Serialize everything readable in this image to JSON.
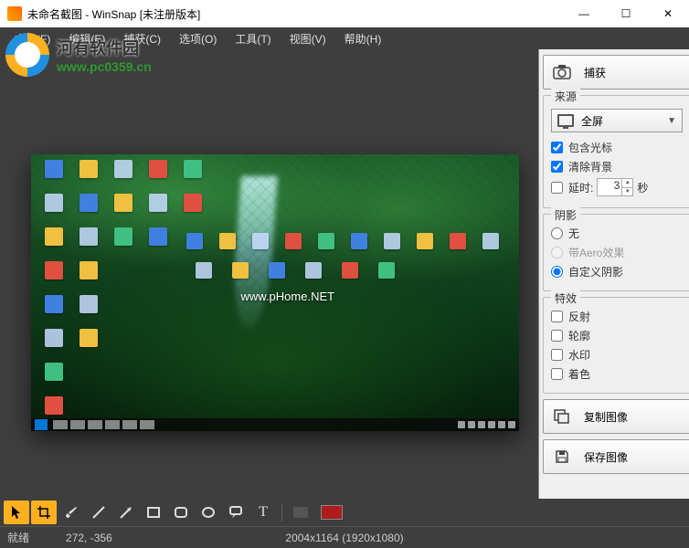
{
  "title": "未命名截图 - WinSnap  [未注册版本]",
  "menu": [
    "文件(F)",
    "编辑(E)",
    "捕获(C)",
    "选项(O)",
    "工具(T)",
    "视图(V)",
    "帮助(H)"
  ],
  "watermark": {
    "line1": "河有软件园",
    "line2": "www.pc0359.cn"
  },
  "phome": "www.pHome.NET",
  "side": {
    "capture": "捕获",
    "source": {
      "title": "来源",
      "fullscreen": "全屏",
      "include_cursor": "包含光标",
      "clear_bg": "清除背景",
      "delay_label": "延时:",
      "delay_val": "3",
      "delay_unit": "秒"
    },
    "shadow": {
      "title": "阴影",
      "none": "无",
      "aero": "带Aero效果",
      "custom": "自定义阴影"
    },
    "fx": {
      "title": "特效",
      "reflect": "反射",
      "outline": "轮廓",
      "watermark": "水印",
      "color": "着色"
    },
    "copy": "复制图像",
    "save": "保存图像"
  },
  "status": {
    "ready": "就绪",
    "coord": "272, -356",
    "dim": "2004x1164 (1920x1080)"
  }
}
